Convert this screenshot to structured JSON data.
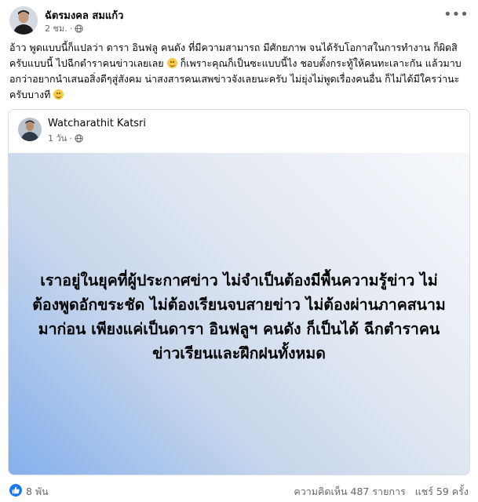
{
  "post": {
    "author": "ฉัตรมงคล สมแก้ว",
    "time": "2 ชม.",
    "separator": "·",
    "privacy_icon": "globe-icon",
    "more_icon": "more-options-icon",
    "text_1": "อ้าว พูดแบบนี้ก็แปลว่า ดารา อินฟลู คนดัง ที่มีความสามารถ มีศักยภาพ จนได้รับโอกาสในการทำงาน ก็ผิดสิ ครับแบบนี้ ไปฉีกตำราคนข่าวเลยเลย",
    "text_2": "ก็เพราะคุณก็เป็นซะแบบนี้ไง ชอบตั้งกระทู้ให้คนทะเลาะกัน แล้วมาบอกว่าอยากนำเสนอสิ่งดีๆสู่สังคม น่าสงสารคนเสพข่าวจังเลยนะครับ ไม่ยุ่งไม่พูดเรื่องคนอื่น ก็ไม่ได้มีใครว่านะครับบางที",
    "emoji": "grinning-face-emoji"
  },
  "shared": {
    "author": "Watcharathit Katsri",
    "time": "1 วัน",
    "separator": "·",
    "quote": "เราอยู่ในยุคที่ผู้ประกาศข่าว ไม่จำเป็นต้องมีพื้นความรู้ข่าว ไม่ต้องพูดอักขระชัด ไม่ต้องเรียนจบสายข่าว ไม่ต้องผ่านภาคสนามมาก่อน เพียงแค่เป็นดารา อินฟลูฯ คนดัง ก็เป็นได้ ฉีกตำราคนข่าวเรียนและฝึกฝนทั้งหมด",
    "gradient": [
      "#f6f8fb",
      "#85b0ec"
    ]
  },
  "footer": {
    "likes": "8 พัน",
    "comments": "ความคิดเห็น 487 รายการ",
    "shares": "แชร์ 59 ครั้ง",
    "like_color": "#1877f2"
  }
}
